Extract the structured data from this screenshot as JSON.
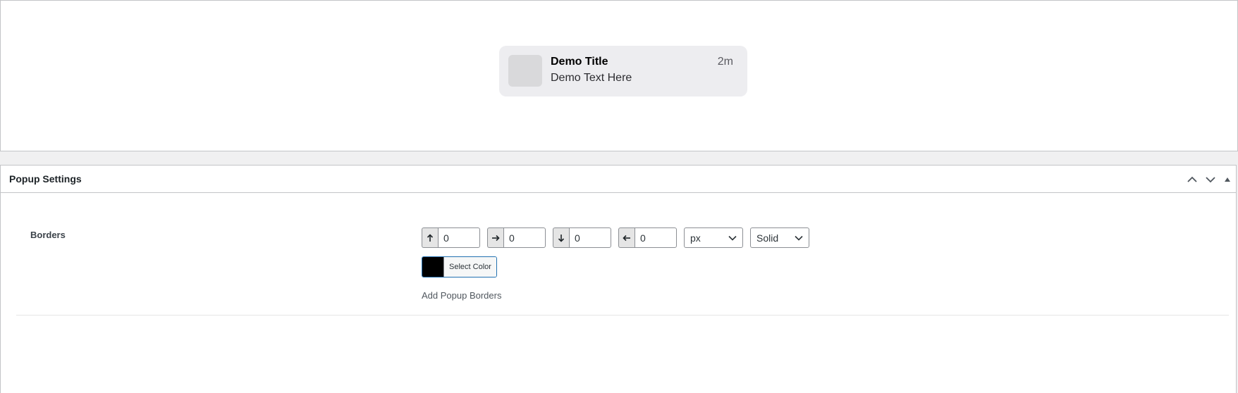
{
  "preview": {
    "notification": {
      "title": "Demo Title",
      "text": "Demo Text Here",
      "time": "2m"
    }
  },
  "settings": {
    "title": "Popup Settings",
    "controls": {
      "move_up_icon": "chevron-up-icon",
      "move_down_icon": "chevron-down-icon",
      "toggle_icon": "triangle-up-icon"
    },
    "borders": {
      "label": "Borders",
      "top": {
        "icon": "arrow-up-icon",
        "value": "0"
      },
      "right": {
        "icon": "arrow-right-icon",
        "value": "0"
      },
      "bottom": {
        "icon": "arrow-down-icon",
        "value": "0"
      },
      "left": {
        "icon": "arrow-left-icon",
        "value": "0"
      },
      "unit": "px",
      "style": "Solid",
      "color_button_label": "Select Color",
      "color_value": "#000000",
      "description": "Add Popup Borders"
    }
  },
  "colors": {
    "accent": "#2271b1",
    "card_bg": "#ededf0",
    "page_bg": "#f0f0f1"
  }
}
